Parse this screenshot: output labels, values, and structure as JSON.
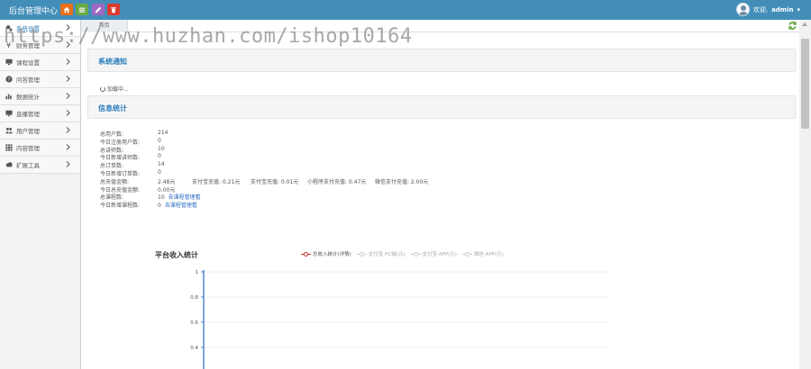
{
  "app": {
    "brand": "后台管理中心"
  },
  "header": {
    "buttons": [
      {
        "icon": "home-icon",
        "color": "#e8701a"
      },
      {
        "icon": "list-icon",
        "color": "#69aa46"
      },
      {
        "icon": "pencil-icon",
        "color": "#a069c3"
      },
      {
        "icon": "trash-icon",
        "color": "#dd3b2f"
      }
    ],
    "user_greeting": "欢迎,",
    "user_name": "admin"
  },
  "sidebar": {
    "items": [
      {
        "label": "系统设置",
        "icon": "gears-icon"
      },
      {
        "label": "财务管理",
        "icon": "yen-icon"
      },
      {
        "label": "课程设置",
        "icon": "monitor-icon"
      },
      {
        "label": "问答管理",
        "icon": "question-icon"
      },
      {
        "label": "数据统计",
        "icon": "bar-chart-icon"
      },
      {
        "label": "直播管理",
        "icon": "monitor-icon"
      },
      {
        "label": "用户管理",
        "icon": "users-icon"
      },
      {
        "label": "内容管理",
        "icon": "grid-icon"
      },
      {
        "label": "扩展工具",
        "icon": "cloud-icon"
      }
    ]
  },
  "tabs": {
    "home": "首页"
  },
  "notice": {
    "title": "系统通知",
    "loading": "加载中..."
  },
  "info": {
    "title": "信息统计",
    "rows": [
      {
        "label": "总用户数:",
        "value": "214"
      },
      {
        "label": "今日注册用户数:",
        "value": "0"
      },
      {
        "label": "总讲师数:",
        "value": "10"
      },
      {
        "label": "今日新增讲师数:",
        "value": "0"
      },
      {
        "label": "总订单数:",
        "value": "14"
      },
      {
        "label": "今日新增订单数:",
        "value": "0"
      },
      {
        "label": "总充值金额:",
        "value": "2.48元",
        "extras": [
          "支付宝充值: 0.21元",
          "支付宝充值: 0.01元",
          "小程序支付充值: 0.47元",
          "微信支付充值: 2.00元"
        ]
      },
      {
        "label": "今日总充值金额:",
        "value": "0.00元"
      },
      {
        "label": "总课程数:",
        "value": "10",
        "link": "去课程管理看"
      },
      {
        "label": "今日新增课程数:",
        "value": "0",
        "link": "去课程管理看"
      }
    ]
  },
  "chart": {
    "title": "平台收入统计",
    "legend": [
      {
        "label": "总收入统计(详情)",
        "active": true
      },
      {
        "label": "支付宝 PC端(元)",
        "active": false
      },
      {
        "label": "支付宝 APP(元)",
        "active": false
      },
      {
        "label": "微信 APP(元)",
        "active": false
      }
    ]
  },
  "chart_data": {
    "type": "line",
    "title": "平台收入统计",
    "series": [
      {
        "name": "总收入统计(详情)",
        "values": []
      },
      {
        "name": "支付宝 PC端(元)",
        "values": []
      },
      {
        "name": "支付宝 APP(元)",
        "values": []
      },
      {
        "name": "微信 APP(元)",
        "values": []
      }
    ],
    "ylim": [
      0,
      1
    ],
    "yticks": [
      "1",
      "0.8",
      "0.6",
      "0.4",
      "0.2"
    ],
    "grid": true,
    "legend_position": "top"
  },
  "watermark": "https://www.huzhan.com/ishop10164",
  "colors": {
    "header": "#438eb9",
    "accent": "#2b7dbc",
    "axis": "#2a6cc4"
  }
}
